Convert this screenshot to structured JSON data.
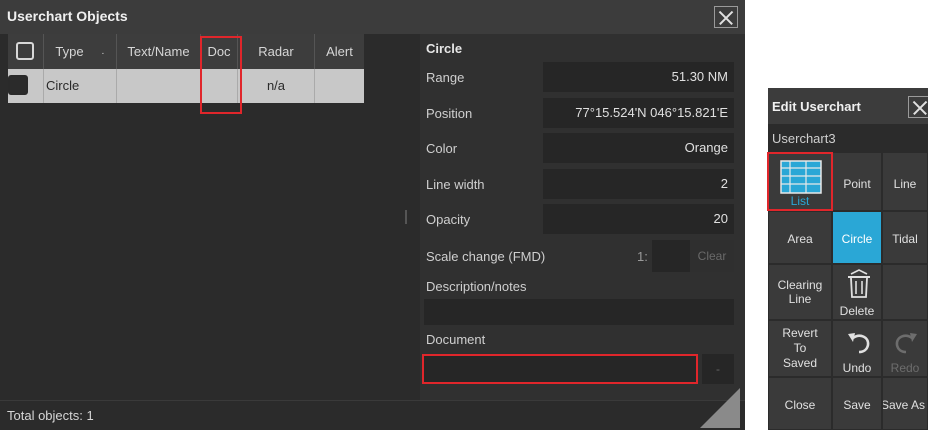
{
  "main_window": {
    "title": "Userchart Objects",
    "close_icon": "close-icon",
    "table": {
      "columns": [
        "Type",
        "Text/Name",
        "Doc",
        "Radar",
        "Alert"
      ],
      "sort_indicator": "·",
      "rows": [
        {
          "type": "Circle",
          "text_name": "",
          "doc": "",
          "radar": "n/a",
          "alert": ""
        }
      ]
    },
    "status": "Total objects: 1"
  },
  "properties": {
    "title": "Circle",
    "range_label": "Range",
    "range_value": "51.30 NM",
    "position_label": "Position",
    "position_value": "77°15.524'N 046°15.821'E",
    "color_label": "Color",
    "color_value": "Orange",
    "line_width_label": "Line width",
    "line_width_value": "2",
    "opacity_label": "Opacity",
    "opacity_value": "20",
    "scale_label": "Scale change (FMD)",
    "scale_prefix": "1:",
    "scale_value": "",
    "clear_label": "Clear",
    "description_label": "Description/notes",
    "description_value": "",
    "document_label": "Document",
    "document_value": "",
    "document_button": "-"
  },
  "edit_panel": {
    "title": "Edit Userchart",
    "chart_name": "Userchart3",
    "buttons": {
      "list": "List",
      "point": "Point",
      "line": "Line",
      "area": "Area",
      "circle": "Circle",
      "tidal": "Tidal",
      "clearing_line_1": "Clearing",
      "clearing_line_2": "Line",
      "delete": "Delete",
      "revert_1": "Revert",
      "revert_2": "To",
      "revert_3": "Saved",
      "undo": "Undo",
      "redo": "Redo",
      "close": "Close",
      "save": "Save",
      "save_as": "Save As"
    }
  },
  "colors": {
    "accent": "#2aa7d6",
    "highlight": "#e0262b",
    "panel_bg": "#2b2b2b"
  }
}
